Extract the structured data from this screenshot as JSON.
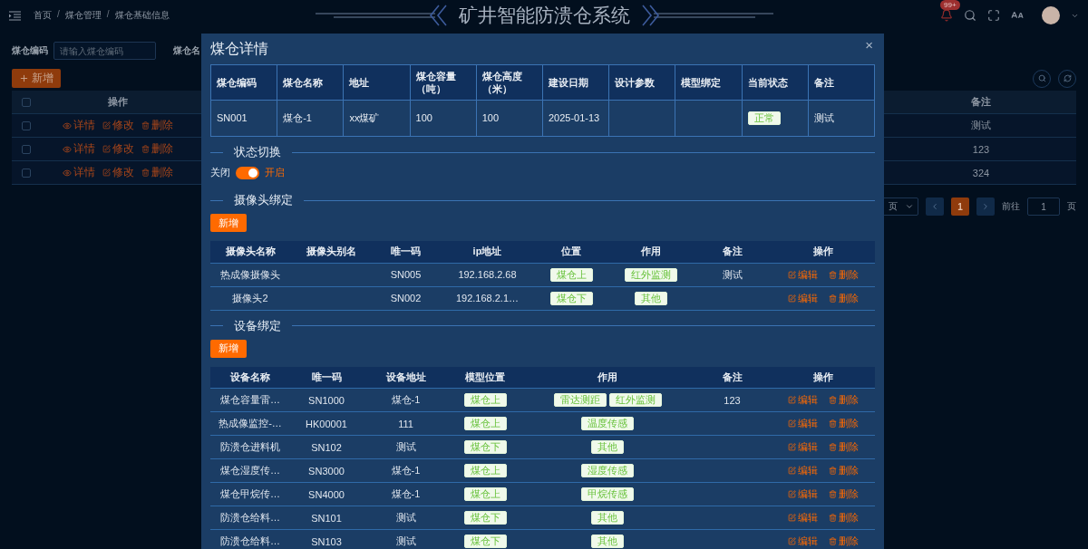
{
  "header": {
    "breadcrumbs": [
      "首页",
      "煤仓管理",
      "煤仓基础信息"
    ],
    "breadcrumb_separator": "/",
    "title": "矿井智能防溃仓系统",
    "notification_badge": "99+"
  },
  "filters": [
    {
      "label": "煤仓编码",
      "placeholder": "请输入煤仓编码"
    },
    {
      "label": "煤仓名"
    }
  ],
  "add_button": "新增",
  "table": {
    "header_checked": false,
    "columns": [
      "操作",
      "备注"
    ],
    "rows": [
      {
        "checked": false,
        "actions": [
          "详情",
          "修改",
          "删除"
        ],
        "remark": "测试"
      },
      {
        "checked": false,
        "actions": [
          "详情",
          "修改",
          "删除"
        ],
        "remark": "123"
      },
      {
        "checked": false,
        "actions": [
          "详情",
          "修改",
          "删除"
        ],
        "remark": "324"
      }
    ]
  },
  "pagination": {
    "page_size": "页",
    "pages": [
      {
        "label": "1",
        "selected": true
      }
    ],
    "goto_label": "前往",
    "goto_value": "1",
    "goto_suffix": "页"
  },
  "dialog": {
    "title": "煤仓详情",
    "close": "×",
    "info_table": {
      "columns": [
        "煤仓编码",
        "煤仓名称",
        "地址",
        "煤仓容量（吨）",
        "煤仓高度（米）",
        "建设日期",
        "设计参数",
        "模型绑定",
        "当前状态",
        "备注"
      ],
      "cells": [
        {
          "kind": "text",
          "text": "SN001"
        },
        {
          "kind": "text",
          "text": "煤仓-1"
        },
        {
          "kind": "text",
          "text": "xx煤矿"
        },
        {
          "kind": "text",
          "text": "100"
        },
        {
          "kind": "text",
          "text": "100"
        },
        {
          "kind": "text",
          "text": "2025-01-13"
        },
        {
          "kind": "blank"
        },
        {
          "kind": "blank"
        },
        {
          "kind": "tag",
          "text": "正常"
        },
        {
          "kind": "text",
          "text": "测试"
        }
      ]
    },
    "status_switch": {
      "title": "状态切换",
      "off_label": "关闭",
      "on_label": "开启",
      "on": true
    },
    "cameras": {
      "title": "摄像头绑定",
      "add_button": "新增",
      "columns": [
        "摄像头名称",
        "摄像头别名",
        "唯一码",
        "ip地址",
        "位置",
        "作用",
        "备注",
        "操作"
      ],
      "rows": [
        {
          "name": "热成像摄像头",
          "code": "SN005",
          "ip": "192.168.2.68",
          "position": "煤仓上",
          "functions": [
            "红外监测"
          ],
          "remark": "测试",
          "actions": [
            "编辑",
            "删除"
          ]
        },
        {
          "name": "摄像头2",
          "code": "SN002",
          "ip": "192.168.2.1…",
          "position": "煤仓下",
          "functions": [
            "其他"
          ],
          "actions": [
            "编辑",
            "删除"
          ]
        }
      ]
    },
    "devices": {
      "title": "设备绑定",
      "add_button": "新增",
      "columns": [
        "设备名称",
        "唯一码",
        "设备地址",
        "模型位置",
        "作用",
        "备注",
        "操作"
      ],
      "rows": [
        {
          "name": "煤仓容量雷…",
          "code": "SN1000",
          "address": "煤仓-1",
          "position": "煤仓上",
          "functions": [
            "雷达测距",
            "红外监测"
          ],
          "remark": "123",
          "actions": [
            "编辑",
            "删除"
          ]
        },
        {
          "name": "热成像监控-…",
          "code": "HK00001",
          "address": "111",
          "position": "煤仓上",
          "functions": [
            "温度传感"
          ],
          "actions": [
            "编辑",
            "删除"
          ]
        },
        {
          "name": "防溃仓进料机",
          "code": "SN102",
          "address": "测试",
          "position": "煤仓下",
          "functions": [
            "其他"
          ],
          "actions": [
            "编辑",
            "删除"
          ]
        },
        {
          "name": "煤仓湿度传…",
          "code": "SN3000",
          "address": "煤仓-1",
          "position": "煤仓上",
          "functions": [
            "湿度传感"
          ],
          "actions": [
            "编辑",
            "删除"
          ]
        },
        {
          "name": "煤仓甲烷传…",
          "code": "SN4000",
          "address": "煤仓-1",
          "position": "煤仓上",
          "functions": [
            "甲烷传感"
          ],
          "actions": [
            "编辑",
            "删除"
          ]
        },
        {
          "name": "防溃仓给料…",
          "code": "SN101",
          "address": "测试",
          "position": "煤仓下",
          "functions": [
            "其他"
          ],
          "actions": [
            "编辑",
            "删除"
          ]
        },
        {
          "name": "防溃仓给料…",
          "code": "SN103",
          "address": "测试",
          "position": "煤仓下",
          "functions": [
            "其他"
          ],
          "actions": [
            "编辑",
            "删除"
          ]
        }
      ]
    }
  }
}
